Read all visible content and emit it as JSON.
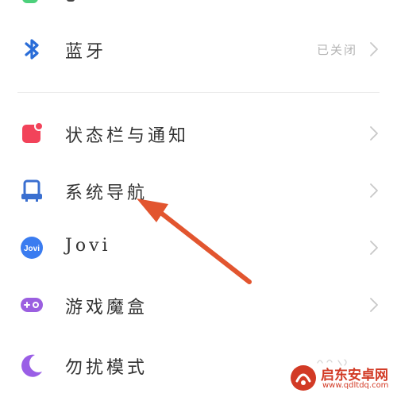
{
  "settings": {
    "items": [
      {
        "id": "bluetooth",
        "icon": "bluetooth-icon",
        "label": "蓝牙",
        "value": "已关闭"
      },
      {
        "id": "statusbar",
        "icon": "status-bar-notification-icon",
        "label": "状态栏与通知",
        "value": ""
      },
      {
        "id": "navigation",
        "icon": "system-navigation-icon",
        "label": "系统导航",
        "value": ""
      },
      {
        "id": "jovi",
        "icon": "jovi-icon",
        "label": "Jovi",
        "icon_text": "Jovi",
        "value": ""
      },
      {
        "id": "game",
        "icon": "gamepad-icon",
        "label": "游戏魔盒",
        "value": ""
      },
      {
        "id": "dnd",
        "icon": "moon-icon",
        "label": "勿扰模式",
        "value": ""
      }
    ]
  },
  "colors": {
    "bluetooth": "#2a6dd8",
    "statusbar": "#f2435a",
    "navigation": "#3a6fd0",
    "jovi": "#3a7cf0",
    "game": "#9b5fe0",
    "dnd": "#9a5ee6",
    "arrow": "#e2552f",
    "watermark": "#d23a25"
  },
  "watermark": {
    "title": "启东安卓网",
    "url": "www.qdltdq.com"
  }
}
